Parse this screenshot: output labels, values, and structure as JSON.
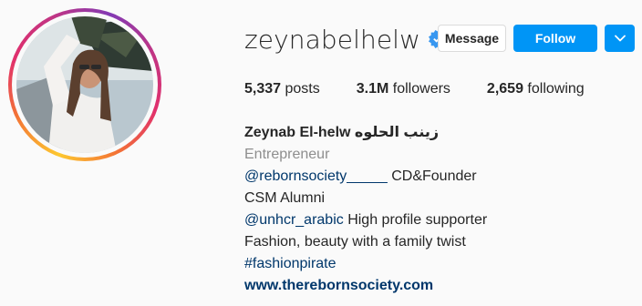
{
  "profile": {
    "username": "zeynabelhelw",
    "verified": true,
    "full_name": "Zeynab El-helw زينب الحلوه",
    "category": "Entrepreneur"
  },
  "actions": {
    "message_label": "Message",
    "follow_label": "Follow"
  },
  "stats": {
    "posts_count": "5,337",
    "posts_label": "posts",
    "followers_count": "3.1M",
    "followers_label": "followers",
    "following_count": "2,659",
    "following_label": "following"
  },
  "bio": {
    "line1_mention": "@rebornsociety_____",
    "line1_text": " CD&Founder",
    "line2": "CSM Alumni",
    "line3_mention": "@unhcr_arabic",
    "line3_text": " High profile supporter",
    "line4": "Fashion, beauty with a family twist",
    "line5_hashtag": "#fashionpirate",
    "website": "www.therebornsociety.com"
  },
  "icons": {
    "verified": "verified-badge-icon",
    "dropdown": "chevron-down-icon"
  },
  "colors": {
    "accent": "#0095f6",
    "verified": "#3897f0",
    "link": "#00376b",
    "muted": "#8e8e8e"
  }
}
